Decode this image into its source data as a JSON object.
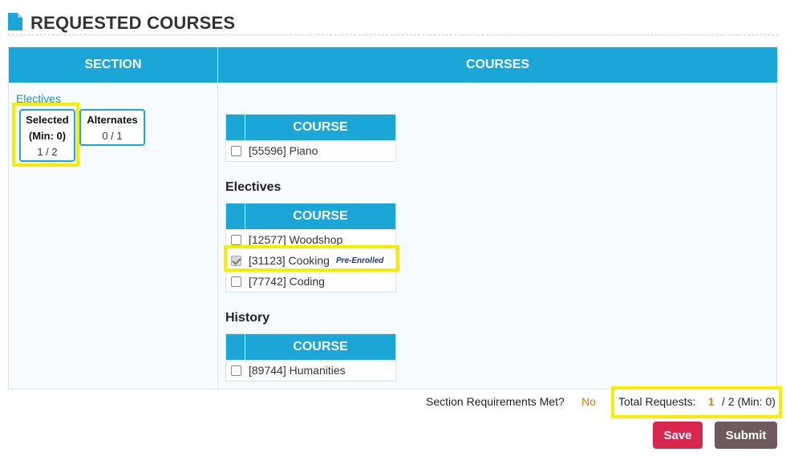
{
  "header": {
    "title": "REQUESTED COURSES",
    "icon": "document-icon"
  },
  "columns": {
    "section": "SECTION",
    "courses": "COURSES"
  },
  "section_panel": {
    "link": "Electives",
    "selected": {
      "label_line1": "Selected",
      "label_line2": "(Min: 0)",
      "value": "1 / 2"
    },
    "alternates": {
      "label": "Alternates",
      "value": "0 / 1"
    }
  },
  "course_groups": [
    {
      "title": "",
      "column": "COURSE",
      "rows": [
        {
          "label": "[55596] Piano",
          "checked": false
        }
      ]
    },
    {
      "title": "Electives",
      "column": "COURSE",
      "rows": [
        {
          "label": "[12577] Woodshop",
          "checked": false
        },
        {
          "label": "[31123] Cooking",
          "checked": true,
          "badge": "Pre-Enrolled"
        },
        {
          "label": "[77742] Coding",
          "checked": false
        }
      ]
    },
    {
      "title": "History",
      "column": "COURSE",
      "rows": [
        {
          "label": "[89744] Humanities",
          "checked": false
        }
      ]
    }
  ],
  "footer": {
    "requirements_label": "Section Requirements Met?",
    "requirements_value": "No",
    "total_label": "Total Requests:",
    "total_count": "1",
    "total_rest": "/ 2 (Min: 0)"
  },
  "buttons": {
    "save": "Save",
    "submit": "Submit"
  },
  "colors": {
    "accent": "#1aa6d6",
    "highlight": "#f5ee00",
    "save": "#d9264f",
    "submit": "#6e5a5e",
    "warning": "#e07b00"
  }
}
